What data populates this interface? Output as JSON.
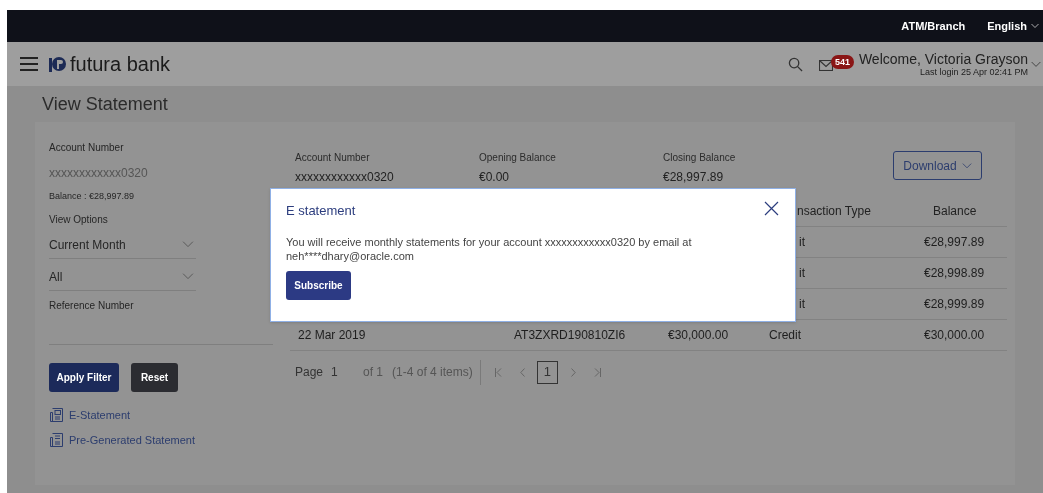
{
  "top_bar": {
    "links": [
      "ATM/Branch",
      "English"
    ]
  },
  "header": {
    "logo": "futura bank",
    "mail_badge": "541",
    "welcome": "Welcome, Victoria Grayson",
    "last_login": "Last login 25 Apr 02:41 PM"
  },
  "page_title": "View Statement",
  "filters": {
    "account_label": "Account Number",
    "account_value": "xxxxxxxxxxxx0320",
    "balance": "Balance : €28,997.89",
    "view_options_label": "View Options",
    "selects": [
      {
        "value": "Current Month"
      },
      {
        "value": "All"
      }
    ],
    "reference_label": "Reference Number",
    "buttons": [
      {
        "label": "Apply Filter",
        "kind": "primary"
      },
      {
        "label": "Reset",
        "kind": "secondary"
      }
    ],
    "links": [
      {
        "label": "E-Statement",
        "kind": "e-statement"
      },
      {
        "label": "Pre-Generated Statement",
        "kind": "pre-generated"
      }
    ]
  },
  "summary": {
    "items": [
      {
        "label": "Account Number",
        "value": "xxxxxxxxxxxx0320"
      },
      {
        "label": "Opening Balance",
        "value": "€0.00"
      },
      {
        "label": "Closing Balance",
        "value": "€28,997.89"
      }
    ],
    "download": "Download"
  },
  "table": {
    "columns": [
      "nsaction Type",
      "Balance"
    ],
    "rows": [
      {
        "type": "it",
        "balance": "€28,997.89"
      },
      {
        "type": "it",
        "balance": "€28,998.89"
      },
      {
        "type": "it",
        "balance": "€28,999.89"
      },
      {
        "date": "22 Mar 2019",
        "reference": "AT3ZXRD190810ZI6",
        "amount": "€30,000.00",
        "type": "Credit",
        "balance": "€30,000.00"
      }
    ]
  },
  "pagination": {
    "page_label": "Page",
    "page_value": "1",
    "of": "of 1",
    "items": "(1-4 of 4 items)",
    "current": "1"
  },
  "modal": {
    "title": "E statement",
    "message": "You will receive monthly statements for your account xxxxxxxxxxxx0320 by email at neh****dhary@oracle.com",
    "button": "Subscribe"
  }
}
